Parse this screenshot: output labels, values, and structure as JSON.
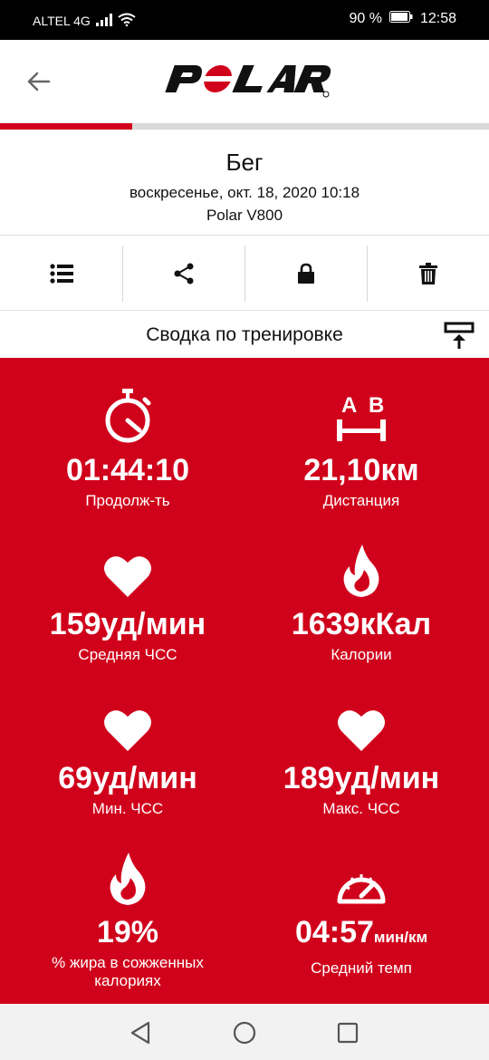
{
  "status_bar": {
    "carrier": "ALTEL 4G",
    "battery": "90 %",
    "time": "12:58"
  },
  "app_bar": {
    "logo_text": "POLAR",
    "brand_color": "#d0021b"
  },
  "progress": {
    "fraction": 0.27
  },
  "workout": {
    "sport": "Бег",
    "date": "воскресенье, окт. 18, 2020 10:18",
    "device": "Polar V800"
  },
  "toolbar": {
    "icons": [
      "list-icon",
      "share-icon",
      "lock-icon",
      "trash-icon"
    ]
  },
  "summary": {
    "title": "Сводка по тренировке"
  },
  "stats": [
    {
      "icon": "stopwatch-icon",
      "value": "01:44:10",
      "unit": "",
      "caption": "Продолж-ть"
    },
    {
      "icon": "distance-ab-icon",
      "value": "21,10",
      "unit": "км",
      "caption": "Дистанция"
    },
    {
      "icon": "heart-icon",
      "value": "159",
      "unit": "уд/мин",
      "caption": "Средняя ЧСС"
    },
    {
      "icon": "flame-icon",
      "value": "1639",
      "unit": "кКал",
      "caption": "Калории"
    },
    {
      "icon": "heart-icon",
      "value": "69",
      "unit": "уд/мин",
      "caption": "Мин. ЧСС"
    },
    {
      "icon": "heart-icon",
      "value": "189",
      "unit": "уд/мин",
      "caption": "Макс. ЧСС"
    },
    {
      "icon": "flame-icon",
      "value": "19%",
      "unit": "",
      "caption": "% жира в сожженных калориях"
    },
    {
      "icon": "speedometer-icon",
      "value": "04:57",
      "unit": "мин/км",
      "caption": "Средний темп"
    }
  ],
  "nav_bar": {
    "buttons": [
      "back-triangle-icon",
      "home-circle-icon",
      "recents-square-icon"
    ]
  }
}
